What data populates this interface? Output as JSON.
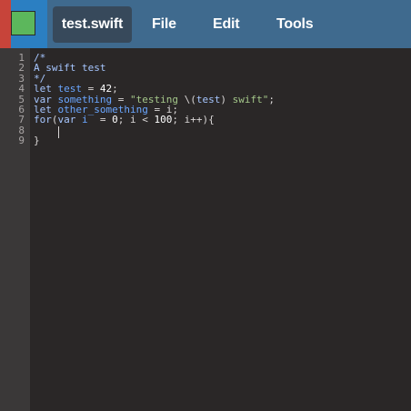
{
  "header": {
    "filename": "test.swift",
    "menu": [
      "File",
      "Edit",
      "Tools"
    ]
  },
  "editor": {
    "line_numbers": [
      "1",
      "2",
      "3",
      "4",
      "5",
      "6",
      "7",
      "8",
      "9"
    ],
    "lines": [
      [
        {
          "t": "cm",
          "v": "/*"
        }
      ],
      [
        {
          "t": "cm",
          "v": "A swift test"
        }
      ],
      [
        {
          "t": "cm",
          "v": "*/"
        }
      ],
      [
        {
          "t": "kw",
          "v": "let"
        },
        {
          "t": "p",
          "v": " "
        },
        {
          "t": "var",
          "v": "test"
        },
        {
          "t": "p",
          "v": " = "
        },
        {
          "t": "num",
          "v": "42"
        },
        {
          "t": "p",
          "v": ";"
        }
      ],
      [
        {
          "t": "kw",
          "v": "var"
        },
        {
          "t": "p",
          "v": " "
        },
        {
          "t": "var",
          "v": "something"
        },
        {
          "t": "p",
          "v": " = "
        },
        {
          "t": "str",
          "v": "\"testing "
        },
        {
          "t": "p",
          "v": "\\("
        },
        {
          "t": "kw",
          "v": "test"
        },
        {
          "t": "p",
          "v": ")"
        },
        {
          "t": "str",
          "v": " swift\""
        },
        {
          "t": "p",
          "v": ";"
        }
      ],
      [
        {
          "t": "kw",
          "v": "let"
        },
        {
          "t": "p",
          "v": " "
        },
        {
          "t": "var",
          "v": "other_something"
        },
        {
          "t": "p",
          "v": " = i;"
        }
      ],
      [
        {
          "t": "kw",
          "v": "for"
        },
        {
          "t": "p",
          "v": "("
        },
        {
          "t": "kw",
          "v": "var"
        },
        {
          "t": "p",
          "v": " "
        },
        {
          "t": "var",
          "v": "i"
        },
        {
          "t": "p",
          "v": "  = "
        },
        {
          "t": "num",
          "v": "0"
        },
        {
          "t": "p",
          "v": "; i < "
        },
        {
          "t": "num",
          "v": "100"
        },
        {
          "t": "p",
          "v": "; i++){"
        }
      ],
      [
        {
          "t": "p",
          "v": ""
        }
      ],
      [
        {
          "t": "p",
          "v": "}"
        }
      ]
    ]
  },
  "colors": {
    "left_bar_red": "#c7443a",
    "left_bar_blue": "#2b7fc2",
    "logo_green": "#5cb75c",
    "menubar": "#3f6a8e",
    "editor_bg": "#2a2727"
  },
  "icons": {
    "app_logo": "app-logo-icon"
  }
}
